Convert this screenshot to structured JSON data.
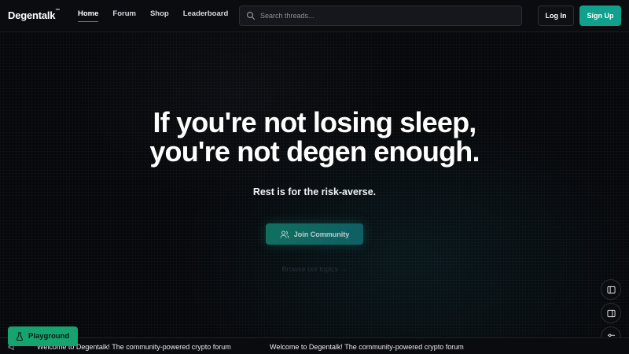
{
  "header": {
    "logo": "Degentalk",
    "logo_tm": "™",
    "nav": [
      {
        "label": "Home",
        "active": true
      },
      {
        "label": "Forum",
        "active": false
      },
      {
        "label": "Shop",
        "active": false
      },
      {
        "label": "Leaderboard",
        "active": false
      }
    ],
    "search_placeholder": "Search threads...",
    "login_label": "Log In",
    "signup_label": "Sign Up"
  },
  "hero": {
    "title_line1": "If you're not losing sleep,",
    "title_line2": "you're not degen enough.",
    "subtitle": "Rest is for the risk-averse.",
    "join_label": "Join Community",
    "browse_label": "Browse our topics →"
  },
  "playground_label": "Playground",
  "ticker": {
    "message_1": "Welcome to Degentalk! The community-powered crypto forum",
    "message_2": "Welcome to Degentalk! The community-powered crypto forum"
  },
  "colors": {
    "accent": "#11a08c",
    "playground": "#15a46f",
    "active_underline": "#e34b4b",
    "background": "#07080b"
  },
  "icons": {
    "search": "search-icon",
    "join": "users-icon",
    "side_1": "sidebar-left-icon",
    "side_2": "sidebar-right-icon",
    "side_3": "sliders-icon",
    "playground": "flask-icon",
    "ticker": "megaphone-icon"
  }
}
